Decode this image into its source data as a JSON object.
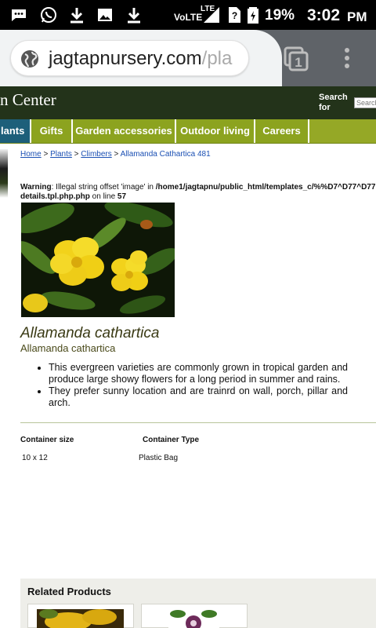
{
  "status_bar": {
    "network": "VoLTE",
    "lte": "LTE",
    "battery": "19%",
    "time": "3:02",
    "ampm": "PM",
    "icons": [
      "message-icon",
      "whatsapp-icon",
      "download-icon",
      "image-icon",
      "download-icon",
      "signal-icon",
      "sim-unknown-icon",
      "battery-icon"
    ]
  },
  "browser": {
    "url_main": "jagtapnursery.com",
    "url_dim": "/pla",
    "tab_count": "1",
    "icons": [
      "globe-icon",
      "tabs-icon",
      "overflow-menu-icon"
    ]
  },
  "site": {
    "title_fragment": "n Center",
    "search_label_1": "Search",
    "search_label_2": "for",
    "search_placeholder": "Search"
  },
  "nav": {
    "items": [
      {
        "label": "lants",
        "active": true
      },
      {
        "label": "Gifts",
        "active": false
      },
      {
        "label": "Garden accessories",
        "active": false
      },
      {
        "label": "Outdoor living",
        "active": false
      },
      {
        "label": "Careers",
        "active": false
      }
    ]
  },
  "breadcrumb": {
    "home": "Home",
    "sep": " > ",
    "plants": "Plants",
    "climbers": "Climbers",
    "current": "Allamanda Cathartica 481"
  },
  "warning": {
    "label": "Warning",
    "text": ": Illegal string offset 'image' in ",
    "path": "/home1/jagtapnu/public_html/templates_c/%%D7^D77^D77",
    "file": "details.tpl.php.php",
    "line_text": " on line ",
    "line": "57"
  },
  "product": {
    "name_italic": "Allamanda cathartica",
    "name_sub": "Allamanda cathartica",
    "bullets": [
      "This evergreen varieties are commonly grown in tropical garden and produce large showy flowers for a long period in summer and rains.",
      "They prefer sunny location and are trainrd on wall, porch, pillar and arch."
    ]
  },
  "specs": {
    "container_size_label": "Container size",
    "container_type_label": "Container Type",
    "container_size": "10 x 12",
    "container_type": "Plastic Bag"
  },
  "related": {
    "title": "Related Products"
  },
  "colors": {
    "header_dark": "#23331a",
    "nav_green": "#8ca31f",
    "nav_active": "#1d5f7a",
    "link": "#1a4fb3"
  }
}
